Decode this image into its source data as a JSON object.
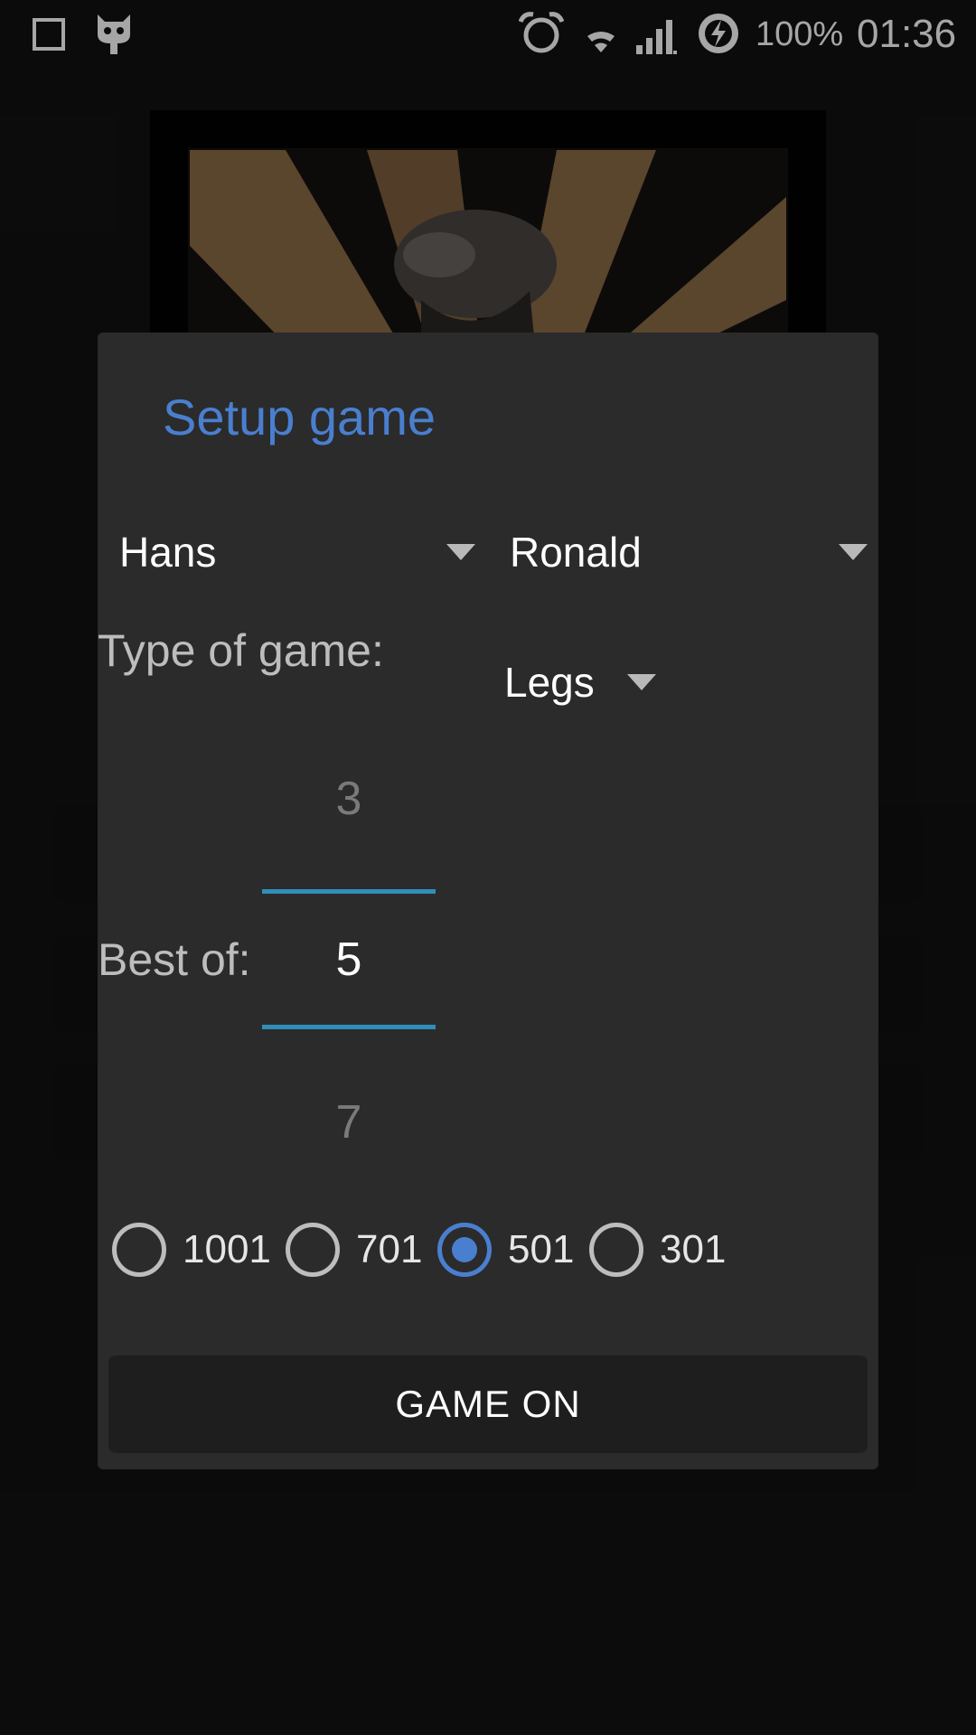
{
  "status_bar": {
    "battery": "100%",
    "time": "01:36",
    "icons": [
      "square-icon",
      "cyanogen-bug-icon",
      "alarm-icon",
      "wifi-icon",
      "signal-icon",
      "battery-charging-icon"
    ]
  },
  "dialog": {
    "title": "Setup game",
    "player1": "Hans",
    "player2": "Ronald",
    "type_label": "Type of game:",
    "type_value": "Legs",
    "best_of_label": "Best of:",
    "picker": {
      "above": "3",
      "selected": "5",
      "below": "7"
    },
    "start_scores": [
      {
        "label": "1001",
        "checked": false
      },
      {
        "label": "701",
        "checked": false
      },
      {
        "label": "501",
        "checked": true
      },
      {
        "label": "301",
        "checked": false
      }
    ],
    "action": "GAME ON"
  },
  "colors": {
    "accent": "#4a7fcf",
    "picker_line": "#2f8fb8",
    "dialog_bg": "#2b2b2c",
    "screen_bg": "#121212"
  }
}
